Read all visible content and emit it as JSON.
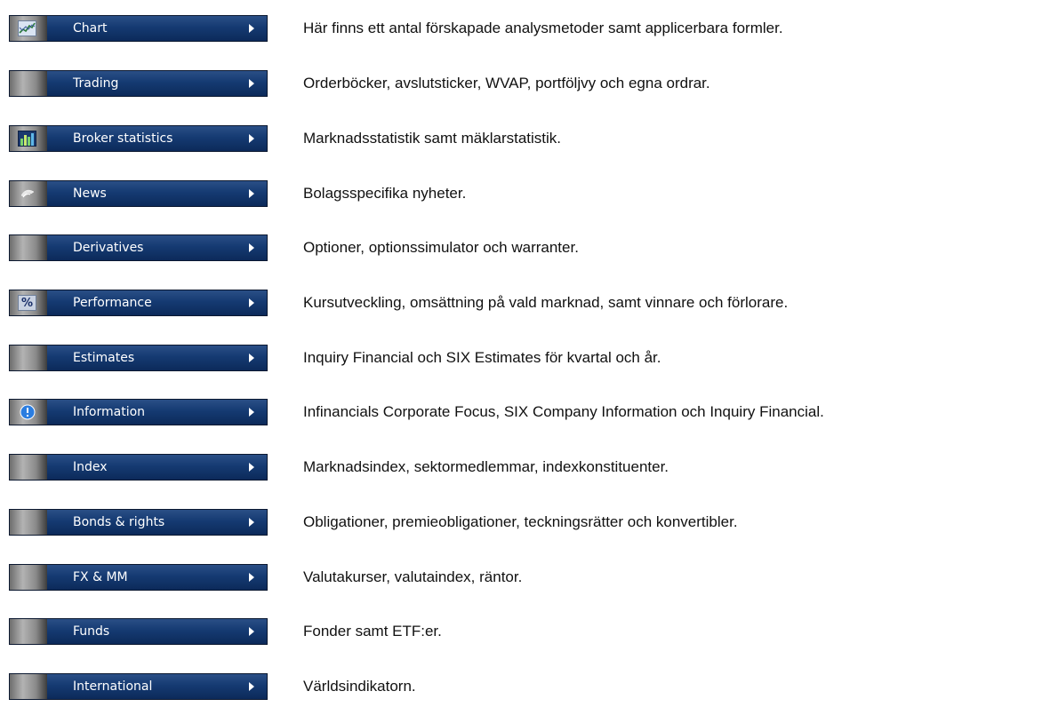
{
  "menu": {
    "items": [
      {
        "label": "Chart",
        "icon": "chart-icon",
        "description": "Här finns ett antal förskapade analysmetoder samt applicerbara formler."
      },
      {
        "label": "Trading",
        "icon": "",
        "description": "Orderböcker, avslutsticker, WVAP, portföljvy och egna ordrar."
      },
      {
        "label": "Broker statistics",
        "icon": "bar-chart-icon",
        "description": "Marknadsstatistik samt mäklarstatistik."
      },
      {
        "label": "News",
        "icon": "news-icon",
        "description": "Bolagsspecifika nyheter."
      },
      {
        "label": "Derivatives",
        "icon": "",
        "description": "Optioner, optionssimulator och warranter."
      },
      {
        "label": "Performance",
        "icon": "percent-icon",
        "description": "Kursutveckling, omsättning på vald marknad, samt vinnare och förlorare."
      },
      {
        "label": "Estimates",
        "icon": "",
        "description": "Inquiry Financial och SIX Estimates för kvartal och år."
      },
      {
        "label": "Information",
        "icon": "info-icon",
        "description": "Infinancials Corporate Focus, SIX Company Information och Inquiry Financial."
      },
      {
        "label": "Index",
        "icon": "",
        "description": "Marknadsindex, sektormedlemmar, indexkonstituenter."
      },
      {
        "label": "Bonds & rights",
        "icon": "",
        "description": "Obligationer, premieobligationer, teckningsrätter och konvertibler."
      },
      {
        "label": "FX & MM",
        "icon": "",
        "description": "Valutakurser, valutaindex, räntor."
      },
      {
        "label": "Funds",
        "icon": "",
        "description": "Fonder samt ETF:er."
      },
      {
        "label": "International",
        "icon": "",
        "description": "Världsindikatorn."
      }
    ]
  },
  "colors": {
    "button_fill": "#153a72",
    "button_border": "#0b1830",
    "button_text": "#ffffff",
    "description_text": "#111111",
    "info_icon": "#2b7de0"
  }
}
